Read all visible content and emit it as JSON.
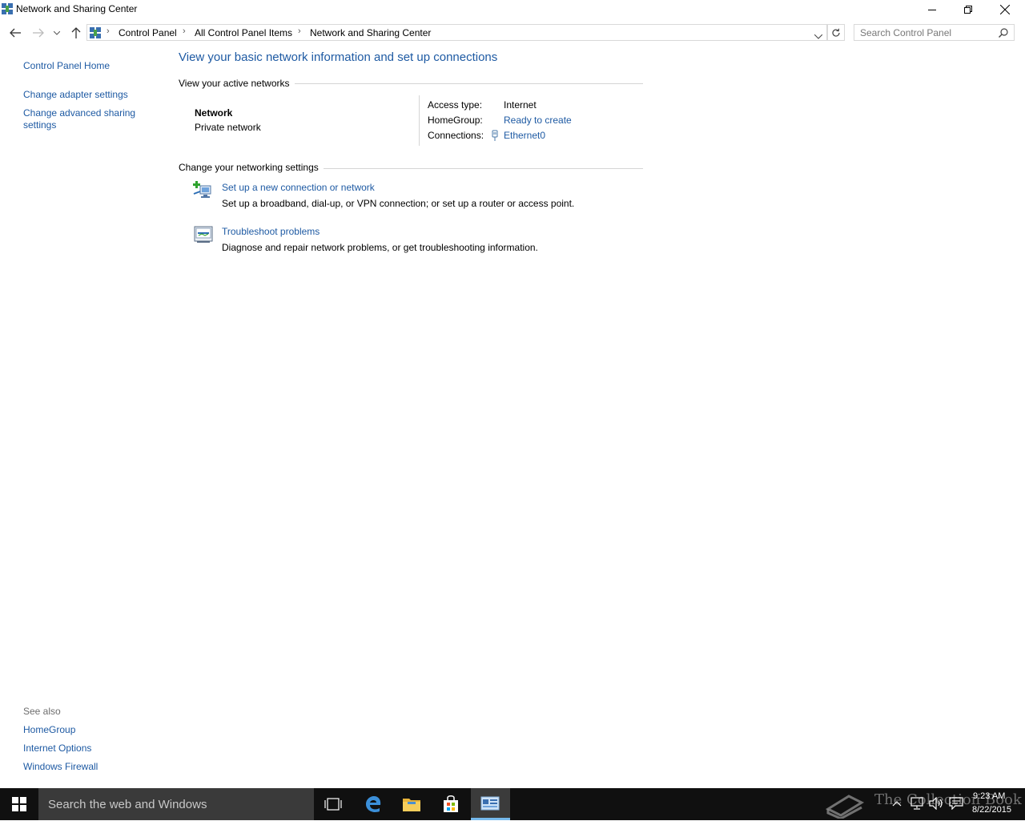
{
  "window": {
    "title": "Network and Sharing Center"
  },
  "address": {
    "crumbs": [
      "Control Panel",
      "All Control Panel Items",
      "Network and Sharing Center"
    ],
    "search_placeholder": "Search Control Panel"
  },
  "left_pane": {
    "links": [
      "Control Panel Home",
      "Change adapter settings",
      "Change advanced sharing settings"
    ],
    "see_also_label": "See also",
    "see_also": [
      "HomeGroup",
      "Internet Options",
      "Windows Firewall"
    ]
  },
  "main": {
    "title": "View your basic network information and set up connections",
    "active_networks_heading": "View your active networks",
    "network_name": "Network",
    "network_type": "Private network",
    "access_type_label": "Access type:",
    "access_type_value": "Internet",
    "homegroup_label": "HomeGroup:",
    "homegroup_value": "Ready to create",
    "connections_label": "Connections:",
    "connections_value": "Ethernet0",
    "change_settings_heading": "Change your networking settings",
    "tasks": [
      {
        "title": "Set up a new connection or network",
        "desc": "Set up a broadband, dial-up, or VPN connection; or set up a router or access point."
      },
      {
        "title": "Troubleshoot problems",
        "desc": "Diagnose and repair network problems, or get troubleshooting information."
      }
    ]
  },
  "taskbar": {
    "search_text": "Search the web and Windows",
    "watermark": "The Collection Book",
    "time": "9:23 AM",
    "date": "8/22/2015"
  },
  "colors": {
    "link": "#1e5aa3",
    "taskbar": "#101010",
    "accent": "#76b9ed"
  }
}
